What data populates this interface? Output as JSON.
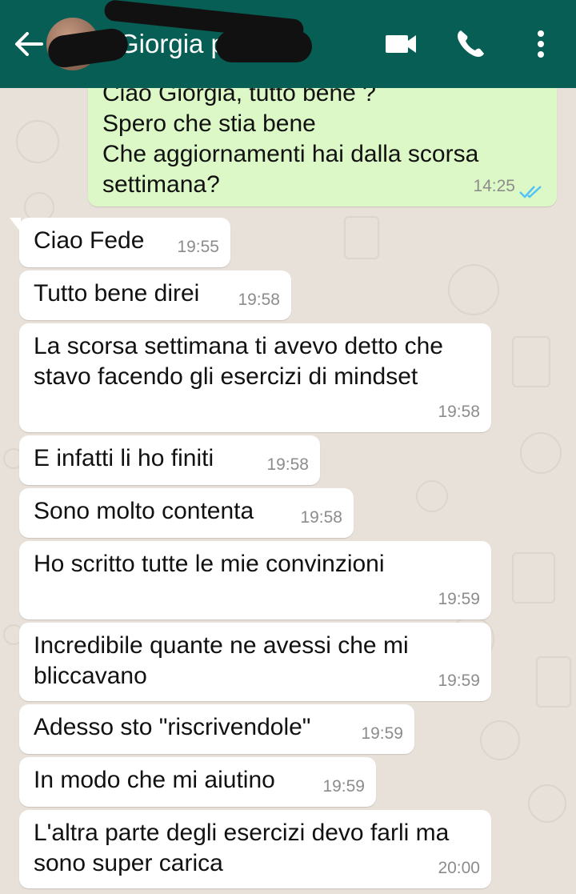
{
  "header": {
    "contact_name": "Giorgia p",
    "icons": {
      "back": "arrow-left-icon",
      "video": "video-camera-icon",
      "call": "phone-icon",
      "menu": "more-vertical-icon"
    },
    "bar_color": "#075e54"
  },
  "messages": [
    {
      "direction": "out",
      "text": "Ciao Giorgia, tutto bene ?\nSpero che stia bene\nChe aggiornamenti hai dalla scorsa\nsettimana?",
      "time": "14:25",
      "status": "read"
    },
    {
      "direction": "in",
      "text": "Ciao Fede",
      "time": "19:55"
    },
    {
      "direction": "in",
      "text": "Tutto bene direi",
      "time": "19:58"
    },
    {
      "direction": "in",
      "text": "La scorsa settimana ti avevo detto che\nstavo facendo gli esercizi di mindset",
      "time": "19:58"
    },
    {
      "direction": "in",
      "text": "E infatti li ho finiti",
      "time": "19:58"
    },
    {
      "direction": "in",
      "text": "Sono molto contenta",
      "time": "19:58"
    },
    {
      "direction": "in",
      "text": "Ho scritto tutte le mie convinzioni",
      "time": "19:59"
    },
    {
      "direction": "in",
      "text": "Incredibile quante ne avessi che mi\nbliccavano",
      "time": "19:59"
    },
    {
      "direction": "in",
      "text": "Adesso sto \"riscrivendole\"",
      "time": "19:59"
    },
    {
      "direction": "in",
      "text": "In modo che mi aiutino",
      "time": "19:59"
    },
    {
      "direction": "in",
      "text": "L'altra parte degli esercizi devo farli ma\nsono super carica",
      "time": "20:00"
    }
  ],
  "colors": {
    "outgoing_bubble": "#dcf8c6",
    "incoming_bubble": "#ffffff",
    "read_ticks": "#4fc3f7",
    "background": "#e7e1d9"
  }
}
